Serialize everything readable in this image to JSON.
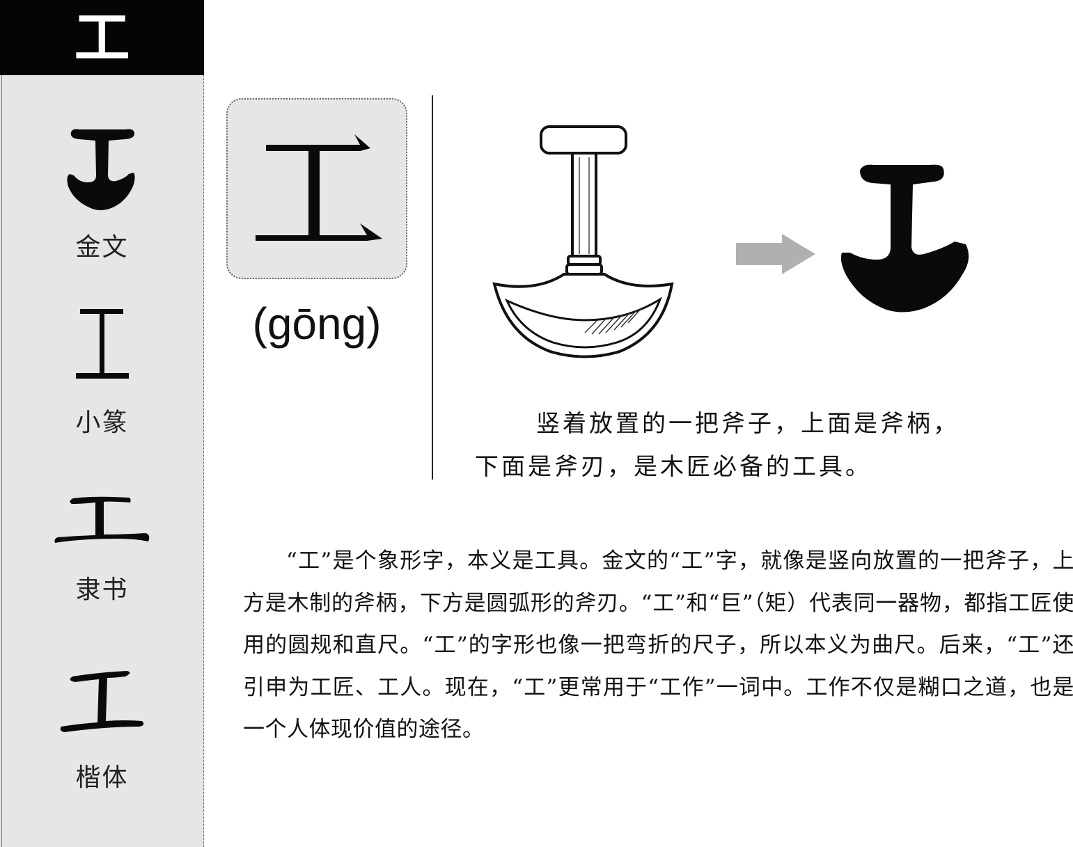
{
  "header": {
    "character": "工"
  },
  "scripts": [
    {
      "label": "金文",
      "style": "bronze-inscription"
    },
    {
      "label": "小篆",
      "style": "small-seal",
      "glyph": "工"
    },
    {
      "label": "隶书",
      "style": "clerical",
      "glyph": "工"
    },
    {
      "label": "楷体",
      "style": "regular",
      "glyph": "工"
    }
  ],
  "card": {
    "character": "工",
    "pinyin": "(gōng)"
  },
  "illustration": {
    "subject": "axe-icon",
    "arrow": "arrow-right-icon",
    "result": "bronze-glyph"
  },
  "caption": {
    "line1": "竖着放置的一把斧子，上面是斧柄，",
    "line2": "下面是斧刃，是木匠必备的工具。"
  },
  "body": {
    "text": "“工”是个象形字，本义是工具。金文的“工”字，就像是竖向放置的一把斧子，上方是木制的斧柄，下方是圆弧形的斧刃。“工”和“巨”（矩）代表同一器物，都指工匠使用的圆规和直尺。“工”的字形也像一把弯折的尺子，所以本义为曲尺。后来，“工”还引申为工匠、工人。现在，“工”更常用于“工作”一词中。工作不仅是糊口之道，也是一个人体现价值的途径。"
  },
  "colors": {
    "sidebar_bg": "#e6e6e6",
    "header_bg": "#050505",
    "arrow": "#b0b0b0",
    "ink": "#0a0a0a"
  }
}
